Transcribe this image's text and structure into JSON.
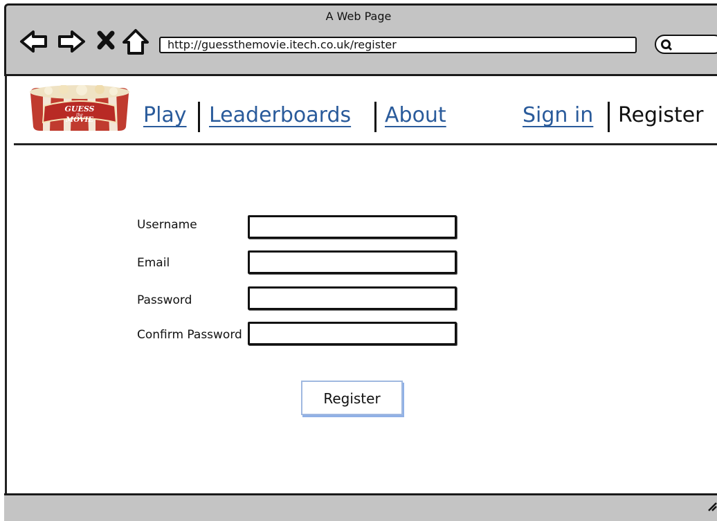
{
  "window": {
    "title": "A Web Page"
  },
  "browser": {
    "url": "http://guessthemovie.itech.co.uk/register",
    "icons": [
      "back-arrow-icon",
      "forward-arrow-icon",
      "stop-icon",
      "home-icon",
      "search-icon"
    ]
  },
  "site": {
    "logo_text_top": "GUESS",
    "logo_text_mid": "the",
    "logo_text_bottom": "MOVIE",
    "nav": {
      "play": "Play",
      "leaderboards": "Leaderboards",
      "about": "About",
      "sign_in": "Sign in",
      "register": "Register"
    }
  },
  "form": {
    "username_label": "Username",
    "email_label": "Email",
    "password_label": "Password",
    "confirm_password_label": "Confirm Password",
    "username_value": "",
    "email_value": "",
    "password_value": "",
    "confirm_password_value": "",
    "submit_label": "Register"
  },
  "colors": {
    "link": "#2a5b9b",
    "chrome": "#c4c4c4",
    "button_border": "#9fb8e0"
  }
}
